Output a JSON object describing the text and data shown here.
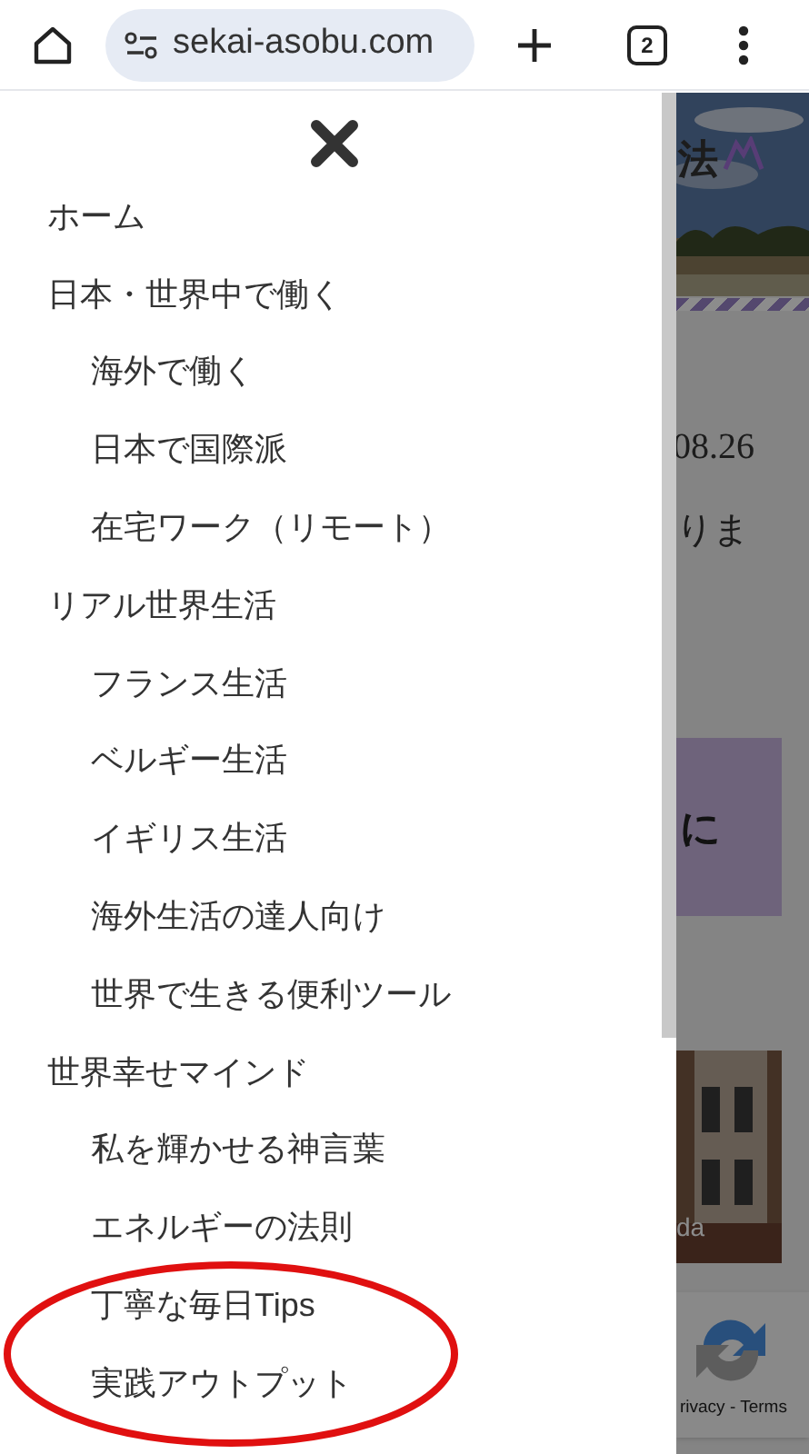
{
  "browser": {
    "url": "sekai-asobu.com",
    "tab_count": "2"
  },
  "menu": {
    "items": [
      {
        "label": "ホーム"
      },
      {
        "label": "日本・世界中で働く",
        "children": [
          {
            "label": "海外で働く"
          },
          {
            "label": "日本で国際派"
          },
          {
            "label": "在宅ワーク（リモート）"
          }
        ]
      },
      {
        "label": "リアル世界生活",
        "children": [
          {
            "label": "フランス生活"
          },
          {
            "label": "ベルギー生活"
          },
          {
            "label": "イギリス生活"
          },
          {
            "label": "海外生活の達人向け"
          },
          {
            "label": "世界で生きる便利ツール"
          }
        ]
      },
      {
        "label": "世界幸せマインド",
        "children": [
          {
            "label": "私を輝かせる神言葉"
          },
          {
            "label": "エネルギーの法則"
          },
          {
            "label": "丁寧な毎日Tips"
          },
          {
            "label": "実践アウトプット"
          }
        ]
      }
    ]
  },
  "background_page": {
    "title_fragment": "法",
    "date_fragment": "08.26",
    "text_fragment": "りま",
    "box_fragment": "に",
    "photo_caption_fragment": "da",
    "recaptcha_links": "rivacy - Terms"
  },
  "annotation": {
    "kind": "ellipse"
  }
}
